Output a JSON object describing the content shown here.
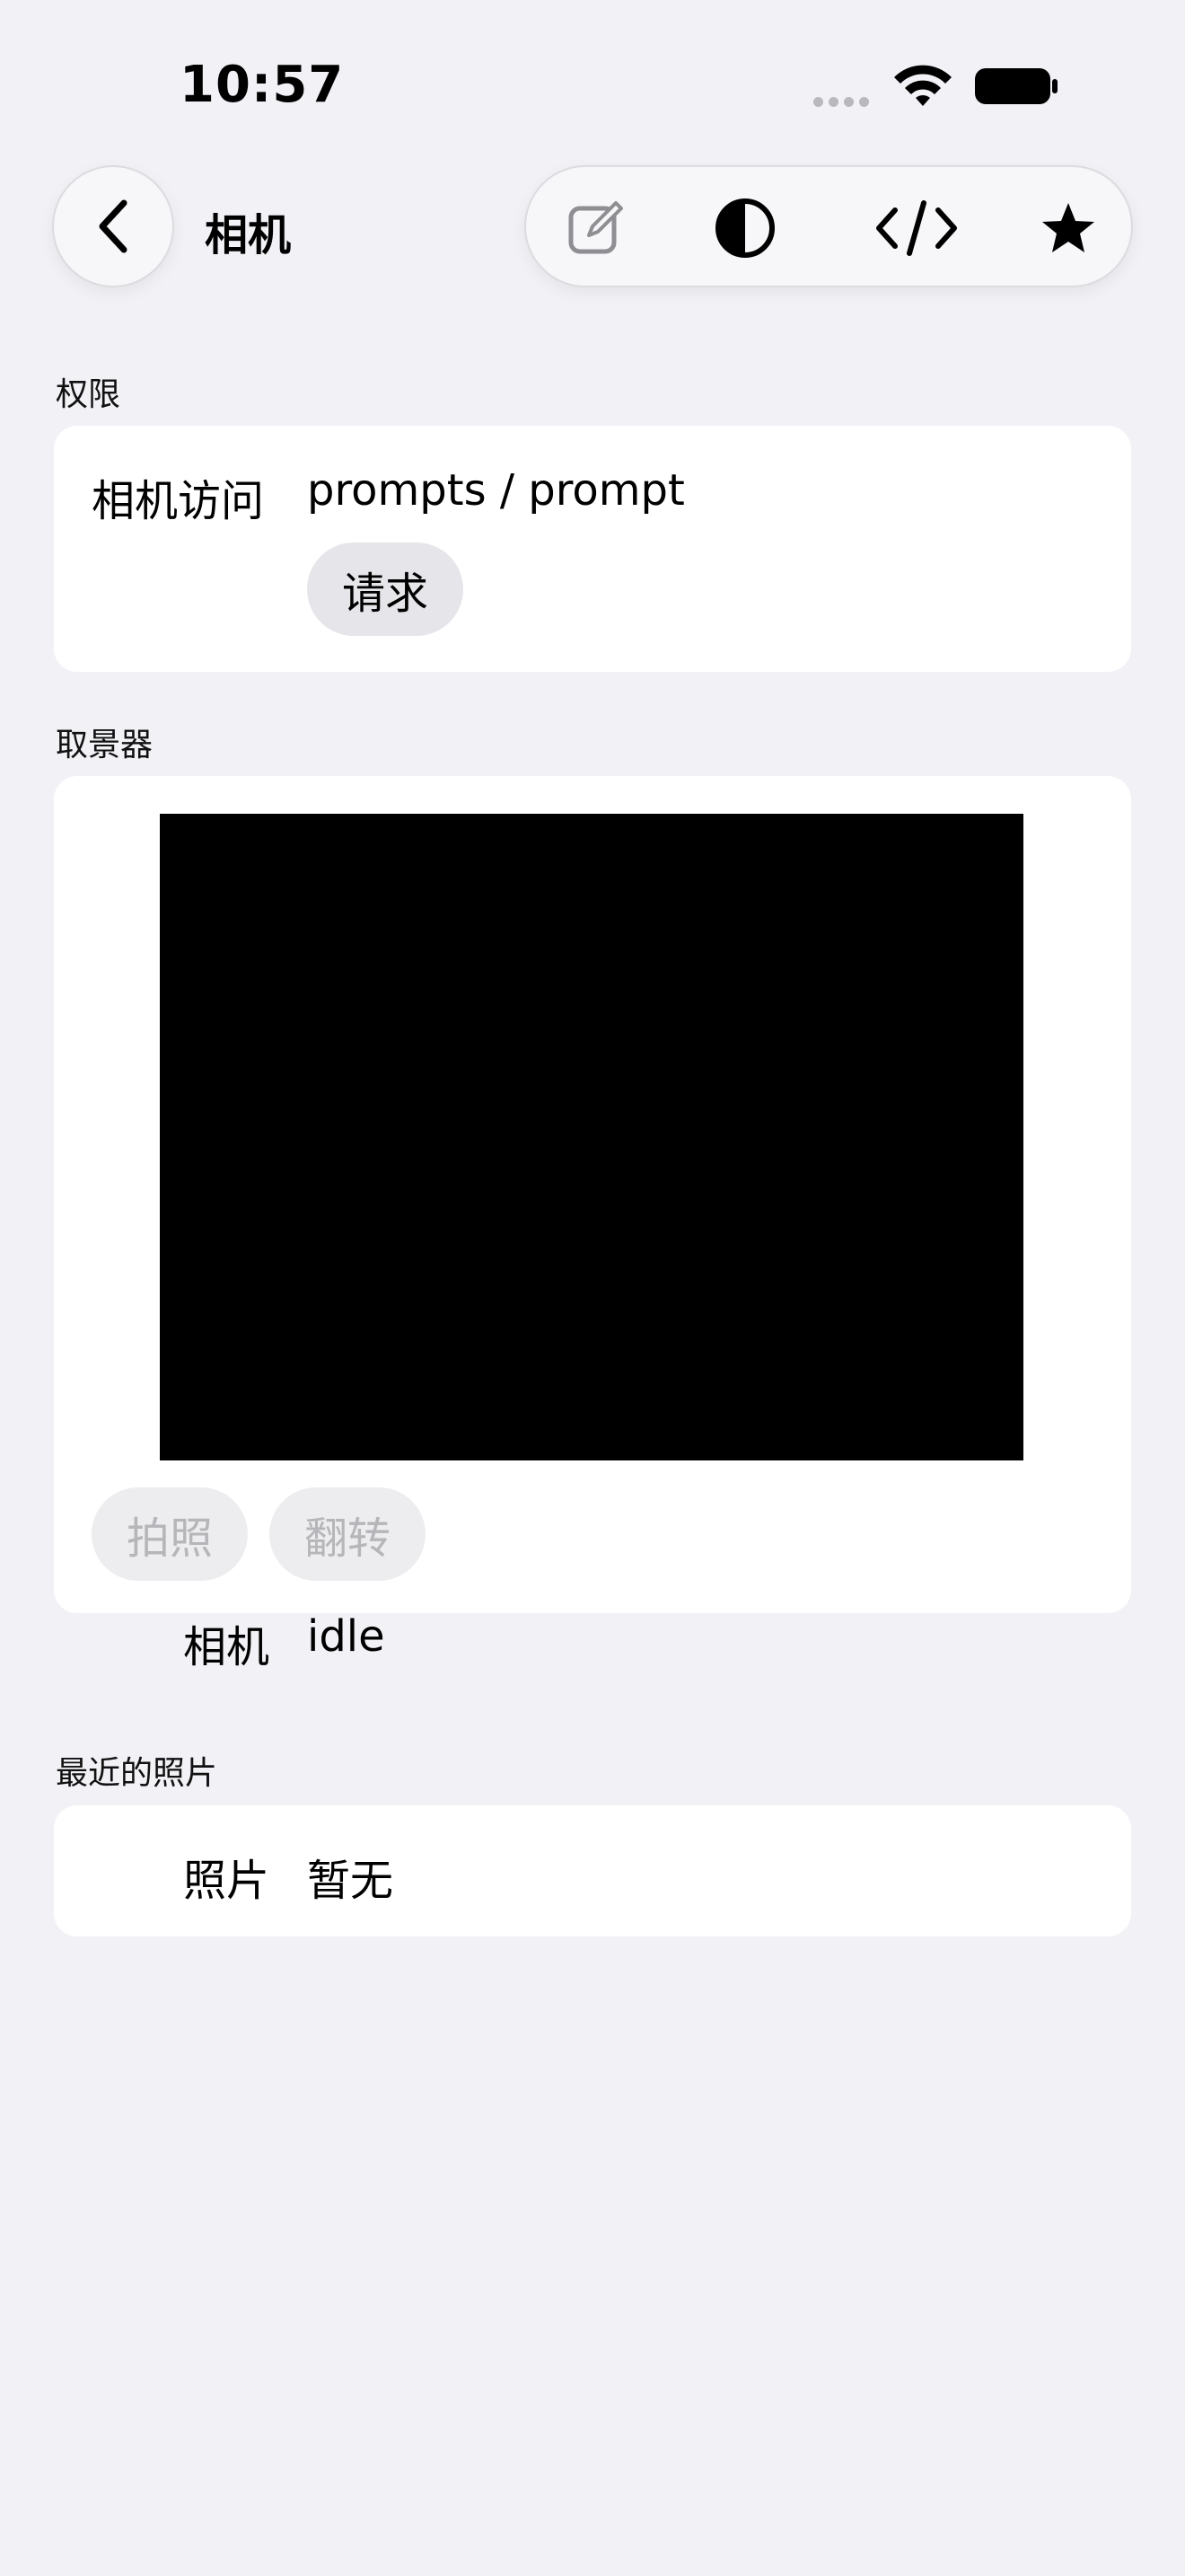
{
  "status_bar": {
    "time": "10:57"
  },
  "nav": {
    "title": "相机",
    "icons": [
      "back-chevron-icon",
      "edit-icon",
      "contrast-icon",
      "code-icon",
      "star-icon"
    ]
  },
  "permissions": {
    "header": "权限",
    "label": "相机访问",
    "value": "prompts / prompt",
    "request_button": "请求"
  },
  "viewfinder": {
    "header": "取景器",
    "capture_button": "拍照",
    "flip_button": "翻转",
    "camera_label": "相机",
    "camera_status": "idle"
  },
  "recent": {
    "header": "最近的照片",
    "photo_label": "照片",
    "photo_value": "暂无"
  },
  "colors": {
    "background": "#f2f1f6",
    "card": "#ffffff",
    "pill_active": "#e6e6ea",
    "pill_disabled_text": "#b6b6ba"
  }
}
